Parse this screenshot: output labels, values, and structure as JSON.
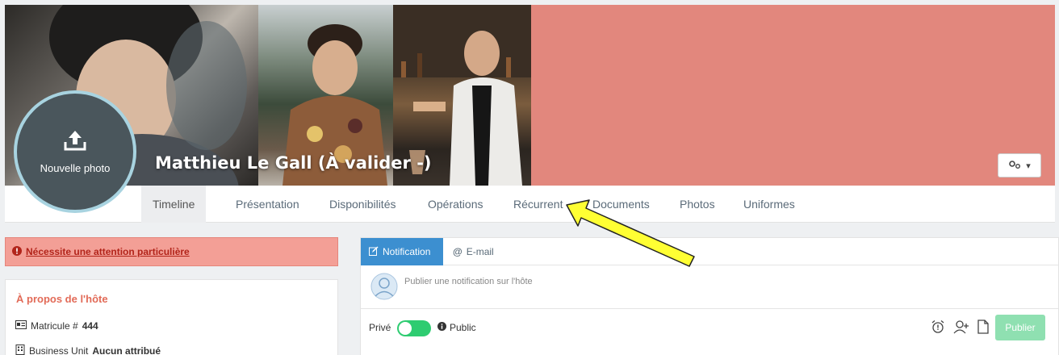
{
  "profile": {
    "name": "Matthieu Le Gall (À valider -)",
    "avatar_label": "Nouvelle photo"
  },
  "tabs": [
    {
      "label": "Timeline",
      "active": true
    },
    {
      "label": "Présentation"
    },
    {
      "label": "Disponibilités"
    },
    {
      "label": "Opérations"
    },
    {
      "label": "Récurrent"
    },
    {
      "label": "Documents"
    },
    {
      "label": "Photos"
    },
    {
      "label": "Uniformes"
    }
  ],
  "alert": {
    "text": "Nécessite une attention particulière"
  },
  "about": {
    "title": "À propos de l'hôte",
    "matricule_label": "Matricule #",
    "matricule_value": "444",
    "bu_label": "Business Unit",
    "bu_value": "Aucun attribué"
  },
  "notify": {
    "tab_notification": "Notification",
    "tab_email": "E-mail",
    "placeholder": "Publier une notification sur l'hôte",
    "private_label": "Privé",
    "public_label": "Public",
    "publish_label": "Publier"
  },
  "colors": {
    "cover": "#e2877d",
    "alert_bg": "#f39f96",
    "accent": "#3c8fd0",
    "toggle": "#2ecc71",
    "arrow": "#ffff33"
  },
  "icons": [
    "upload-icon",
    "gears-icon",
    "caret-down-icon",
    "exclamation-circle-icon",
    "id-card-icon",
    "building-icon",
    "edit-icon",
    "at-icon",
    "user-avatar-icon",
    "info-circle-icon",
    "alarm-clock-icon",
    "user-plus-icon",
    "file-icon"
  ]
}
